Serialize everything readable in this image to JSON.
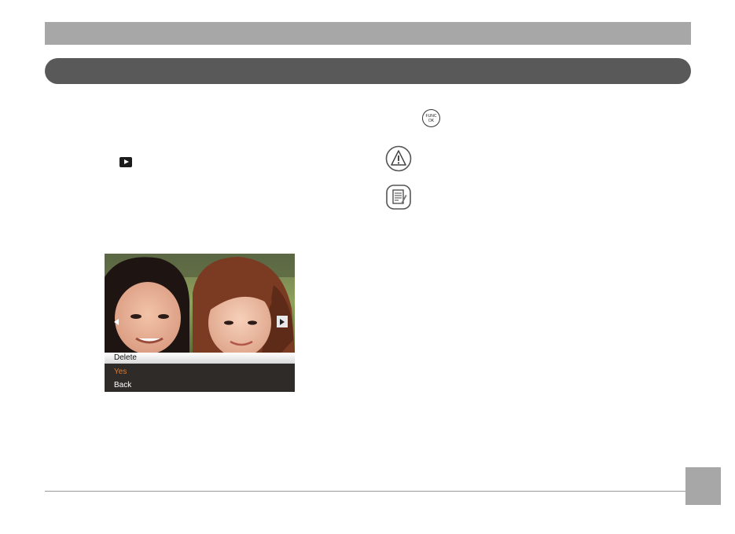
{
  "screen": {
    "menu_title": "Delete",
    "options": [
      "Yes",
      "Back"
    ]
  },
  "icons": {
    "playback": "playback-button-icon",
    "func_ok": {
      "line1": "FUNC",
      "line2": "OK"
    },
    "caution": "caution-triangle-icon",
    "note": "note-memo-icon"
  },
  "colors": {
    "top_bar": "#a7a7a7",
    "section_bar": "#595959",
    "selected_option": "#e07b2c"
  }
}
